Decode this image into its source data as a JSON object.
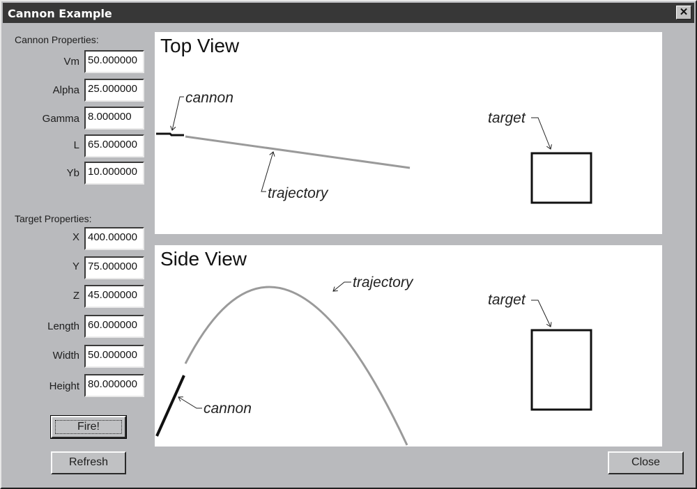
{
  "window": {
    "title": "Cannon Example",
    "close_icon": "close-x-icon"
  },
  "cannon_properties": {
    "label": "Cannon Properties:",
    "fields": [
      {
        "label": "Vm",
        "value": "50.000000"
      },
      {
        "label": "Alpha",
        "value": "25.000000"
      },
      {
        "label": "Gamma",
        "value": "8.000000"
      },
      {
        "label": "L",
        "value": "65.000000"
      },
      {
        "label": "Yb",
        "value": "10.000000"
      }
    ]
  },
  "target_properties": {
    "label": "Target Properties:",
    "fields": [
      {
        "label": "X",
        "value": "400.00000"
      },
      {
        "label": "Y",
        "value": "75.000000"
      },
      {
        "label": "Z",
        "value": "45.000000"
      },
      {
        "label": "Length",
        "value": "60.000000"
      },
      {
        "label": "Width",
        "value": "50.000000"
      },
      {
        "label": "Height",
        "value": "80.000000"
      }
    ]
  },
  "buttons": {
    "fire": "Fire!",
    "refresh": "Refresh",
    "close": "Close"
  },
  "top_view": {
    "title": "Top View",
    "annotations": {
      "cannon": "cannon",
      "trajectory": "trajectory",
      "target": "target"
    }
  },
  "side_view": {
    "title": "Side View",
    "annotations": {
      "cannon": "cannon",
      "trajectory": "trajectory",
      "target": "target"
    }
  },
  "colors": {
    "dialog_bg": "#b9babd",
    "titlebar": "#373737",
    "trajectory": "#9a9a9a",
    "cannon": "#111111",
    "target": "#111111"
  }
}
